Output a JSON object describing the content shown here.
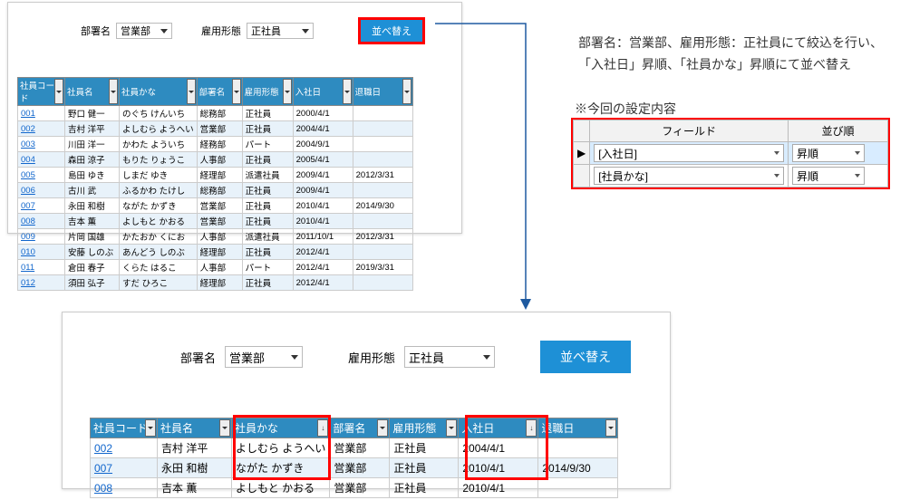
{
  "filters": {
    "dept_label": "部署名",
    "dept_value": "営業部",
    "emptype_label": "雇用形態",
    "emptype_value": "正社員",
    "sort_button": "並べ替え"
  },
  "columns": {
    "code": "社員コード",
    "name": "社員名",
    "kana": "社員かな",
    "dept": "部署名",
    "emptype": "雇用形態",
    "hire": "入社日",
    "leave": "退職日"
  },
  "rows_before": [
    {
      "code": "001",
      "name": "野口 健一",
      "kana": "のぐち けんいち",
      "dept": "総務部",
      "emptype": "正社員",
      "hire": "2000/4/1",
      "leave": ""
    },
    {
      "code": "002",
      "name": "吉村 洋平",
      "kana": "よしむら ようへい",
      "dept": "営業部",
      "emptype": "正社員",
      "hire": "2004/4/1",
      "leave": ""
    },
    {
      "code": "003",
      "name": "川田 洋一",
      "kana": "かわた よういち",
      "dept": "経務部",
      "emptype": "パート",
      "hire": "2004/9/1",
      "leave": ""
    },
    {
      "code": "004",
      "name": "森田 涼子",
      "kana": "もりた りょうこ",
      "dept": "人事部",
      "emptype": "正社員",
      "hire": "2005/4/1",
      "leave": ""
    },
    {
      "code": "005",
      "name": "島田 ゆき",
      "kana": "しまだ ゆき",
      "dept": "経理部",
      "emptype": "派遣社員",
      "hire": "2009/4/1",
      "leave": "2012/3/31"
    },
    {
      "code": "006",
      "name": "古川 武",
      "kana": "ふるかわ たけし",
      "dept": "総務部",
      "emptype": "正社員",
      "hire": "2009/4/1",
      "leave": ""
    },
    {
      "code": "007",
      "name": "永田 和樹",
      "kana": "ながた かずき",
      "dept": "営業部",
      "emptype": "正社員",
      "hire": "2010/4/1",
      "leave": "2014/9/30"
    },
    {
      "code": "008",
      "name": "吉本 薫",
      "kana": "よしもと かおる",
      "dept": "営業部",
      "emptype": "正社員",
      "hire": "2010/4/1",
      "leave": ""
    },
    {
      "code": "009",
      "name": "片岡 国雄",
      "kana": "かたおか くにお",
      "dept": "人事部",
      "emptype": "派遣社員",
      "hire": "2011/10/1",
      "leave": "2012/3/31"
    },
    {
      "code": "010",
      "name": "安藤 しのぶ",
      "kana": "あんどう しのぶ",
      "dept": "経理部",
      "emptype": "正社員",
      "hire": "2012/4/1",
      "leave": ""
    },
    {
      "code": "011",
      "name": "倉田 春子",
      "kana": "くらた はるこ",
      "dept": "人事部",
      "emptype": "パート",
      "hire": "2012/4/1",
      "leave": "2019/3/31"
    },
    {
      "code": "012",
      "name": "須田 弘子",
      "kana": "すだ ひろこ",
      "dept": "経理部",
      "emptype": "正社員",
      "hire": "2012/4/1",
      "leave": ""
    }
  ],
  "rows_after": [
    {
      "code": "002",
      "name": "吉村 洋平",
      "kana": "よしむら ようへい",
      "dept": "営業部",
      "emptype": "正社員",
      "hire": "2004/4/1",
      "leave": ""
    },
    {
      "code": "007",
      "name": "永田 和樹",
      "kana": "ながた かずき",
      "dept": "営業部",
      "emptype": "正社員",
      "hire": "2010/4/1",
      "leave": "2014/9/30"
    },
    {
      "code": "008",
      "name": "吉本 薫",
      "kana": "よしもと かおる",
      "dept": "営業部",
      "emptype": "正社員",
      "hire": "2010/4/1",
      "leave": ""
    }
  ],
  "description": {
    "line1": "部署名：営業部、雇用形態：正社員にて絞込を行い、",
    "line2": "「入社日」昇順、「社員かな」昇順にて並べ替え"
  },
  "note_title": "※今回の設定内容",
  "settings": {
    "field_header": "フィールド",
    "order_header": "並び順",
    "rows": [
      {
        "field": "[入社日]",
        "order": "昇順",
        "marker": "▶"
      },
      {
        "field": "[社員かな]",
        "order": "昇順",
        "marker": ""
      }
    ]
  }
}
